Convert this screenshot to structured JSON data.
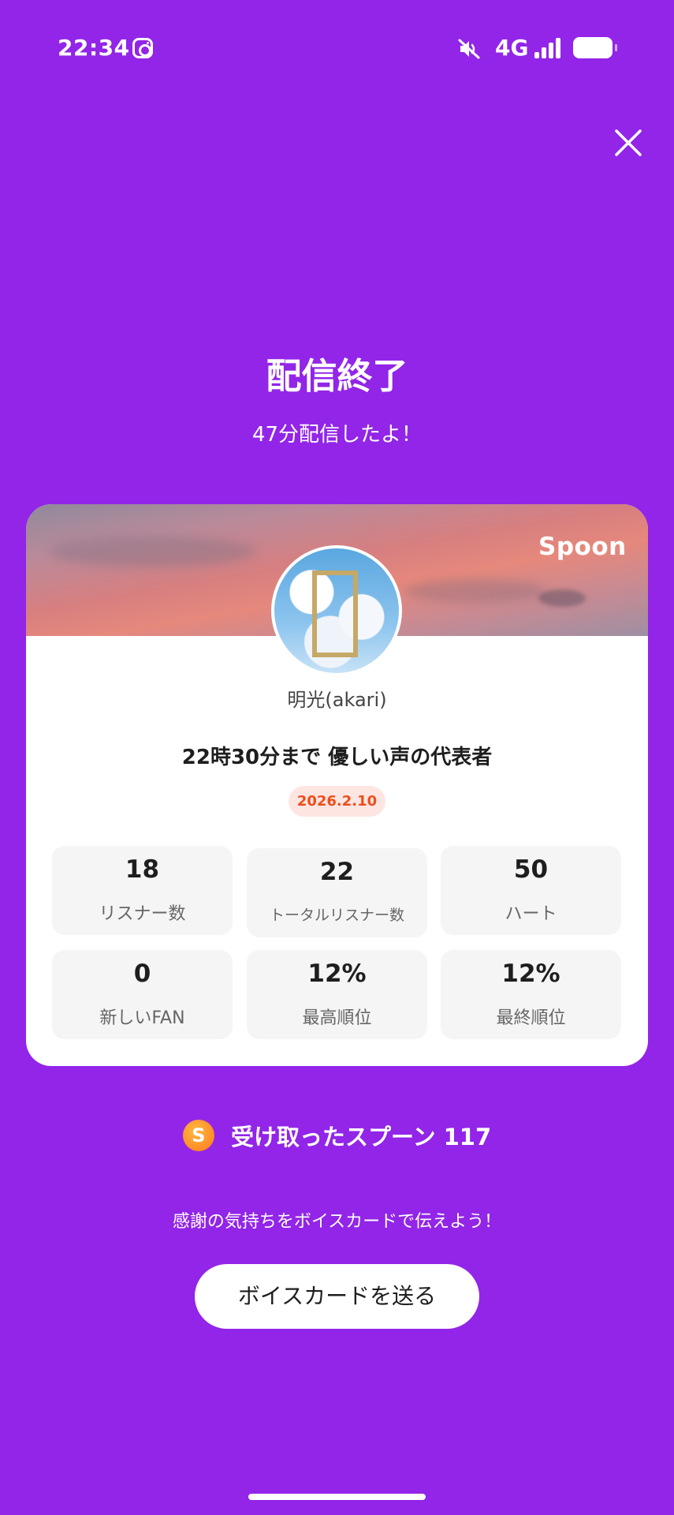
{
  "status_bar": {
    "time": "22:34",
    "network": "4G",
    "icons": [
      "instagram-icon",
      "mute-icon",
      "signal-icon",
      "battery-icon"
    ]
  },
  "header": {
    "close_icon": "close-icon",
    "title": "配信終了",
    "subtitle": "47分配信したよ！"
  },
  "card": {
    "brand": "Spoon",
    "username": "明光(akari)",
    "broadcast_title": "22時30分まで  優しい声の代表者",
    "date": "2026.2.10",
    "stats": [
      {
        "value": "18",
        "label": "リスナー数"
      },
      {
        "value": "22",
        "label": "トータルリスナー数"
      },
      {
        "value": "50",
        "label": "ハート"
      },
      {
        "value": "0",
        "label": "新しいFAN"
      },
      {
        "value": "12%",
        "label": "最高順位"
      },
      {
        "value": "12%",
        "label": "最終順位"
      }
    ]
  },
  "spoons": {
    "icon_letter": "S",
    "text": "受け取ったスプーン  117"
  },
  "voice_card": {
    "prompt": "感謝の気持ちをボイスカードで伝えよう！",
    "button_label": "ボイスカードを送る"
  },
  "colors": {
    "background": "#9225e8",
    "date_badge_text": "#f04d1b",
    "date_badge_bg": "#fde6e2",
    "spoon_icon": "#ff8a1e"
  }
}
